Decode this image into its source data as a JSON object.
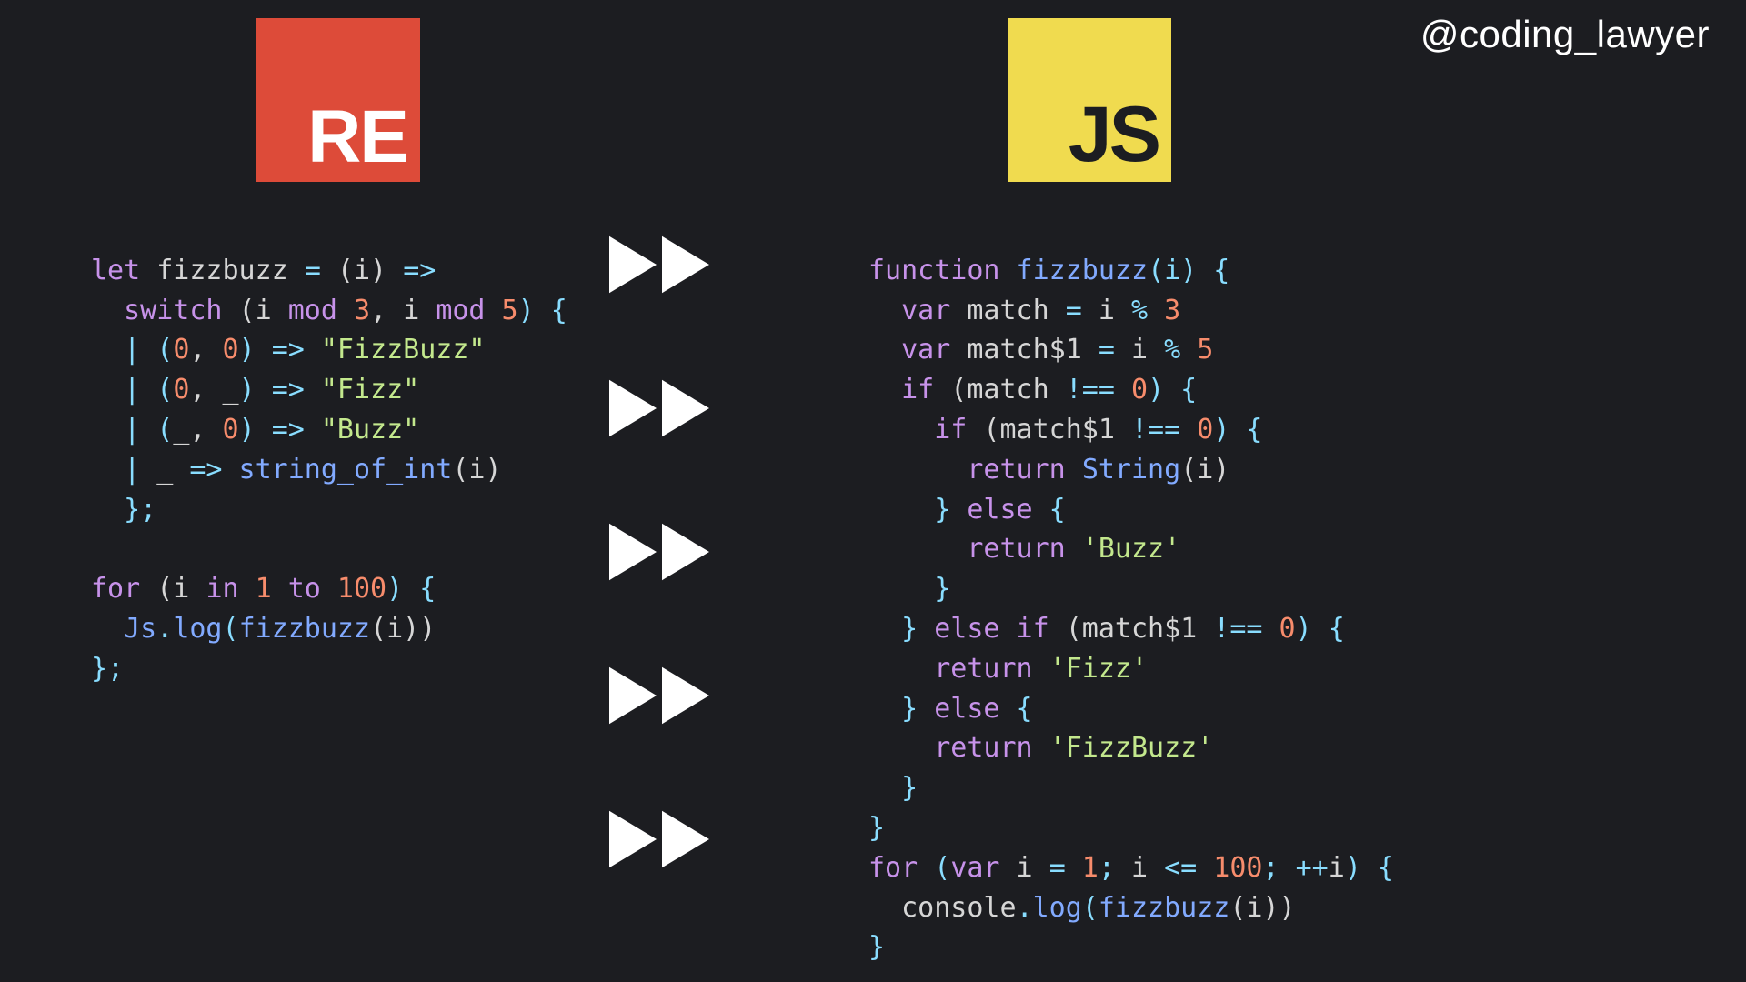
{
  "handle": "@coding_lawyer",
  "logos": {
    "reason": "RE",
    "js": "JS"
  },
  "reason_code": {
    "l1": {
      "let": "let",
      "name": " fizzbuzz ",
      "eq": "=",
      "params": " (i) ",
      "arrow": "=>"
    },
    "l2": {
      "sw": "switch",
      "open": " (i ",
      "mod1": "mod",
      "n3": " 3",
      "comma": ", ",
      "i2": "i ",
      "mod2": "mod",
      "n5": " 5",
      "close": ") {"
    },
    "l3": {
      "bar": "| (",
      "z1": "0",
      "c": ", ",
      "z2": "0",
      "close": ") ",
      "arrow": "=>",
      "str": " \"FizzBuzz\""
    },
    "l4": {
      "bar": "| (",
      "z1": "0",
      "c": ", ",
      "u": "_",
      "close": ") ",
      "arrow": "=>",
      "str": " \"Fizz\""
    },
    "l5": {
      "bar": "| (",
      "u": "_",
      "c": ", ",
      "z2": "0",
      "close": ") ",
      "arrow": "=>",
      "str": " \"Buzz\""
    },
    "l6": {
      "bar": "| ",
      "u": "_ ",
      "arrow": "=>",
      "fn": " string_of_int",
      "args": "(i)"
    },
    "l7": {
      "close": "};"
    },
    "l8": {
      "txt": ""
    },
    "l9": {
      "for": "for",
      "open": " (i ",
      "in": "in",
      "n1": " 1 ",
      "to": "to",
      "n100": " 100",
      "close": ") {"
    },
    "l10": {
      "js": "Js",
      "dot": ".",
      "log": "log",
      "open": "(",
      "fb": "fizzbuzz",
      "args": "(i))"
    },
    "l11": {
      "close": "};"
    }
  },
  "js_code": {
    "l1": {
      "fn": "function",
      "name": " fizzbuzz",
      "params": "(i) {"
    },
    "l2": {
      "var": "var",
      "m": " match ",
      "eq": "=",
      "i": " i ",
      "pct": "%",
      "n": " 3"
    },
    "l3": {
      "var": "var",
      "m": " match$1 ",
      "eq": "=",
      "i": " i ",
      "pct": "%",
      "n": " 5"
    },
    "l4": {
      "if": "if",
      "open": " (match ",
      "neq": "!==",
      "z": " 0",
      "close": ") {"
    },
    "l5": {
      "if": "if",
      "open": " (match$1 ",
      "neq": "!==",
      "z": " 0",
      "close": ") {"
    },
    "l6": {
      "ret": "return",
      "sp": " ",
      "str": "String",
      "args": "(i)"
    },
    "l7": {
      "close": "} ",
      "else": "else",
      "brace": " {"
    },
    "l8": {
      "ret": "return",
      "sp": " ",
      "s": "'Buzz'"
    },
    "l9": {
      "close": "}"
    },
    "l10": {
      "close": "} ",
      "else": "else",
      "if": " if",
      "open": " (match$1 ",
      "neq": "!==",
      "z": " 0",
      "close2": ") {"
    },
    "l11": {
      "ret": "return",
      "sp": " ",
      "s": "'Fizz'"
    },
    "l12": {
      "close": "} ",
      "else": "else",
      "brace": " {"
    },
    "l13": {
      "ret": "return",
      "sp": " ",
      "s": "'FizzBuzz'"
    },
    "l14": {
      "close": "}"
    },
    "l15": {
      "close": "}"
    },
    "l16": {
      "for": "for",
      "open": " (",
      "var": "var",
      "i": " i ",
      "eq": "=",
      "one": " 1",
      "semi": "; ",
      "i2": "i ",
      "lte": "<=",
      "h": " 100",
      "semi2": "; ",
      "inc": "++",
      "i3": "i",
      "close": ") {"
    },
    "l17": {
      "con": "console",
      "dot": ".",
      "log": "log",
      "open": "(",
      "fb": "fizzbuzz",
      "args": "(i))"
    },
    "l18": {
      "close": "}"
    }
  }
}
